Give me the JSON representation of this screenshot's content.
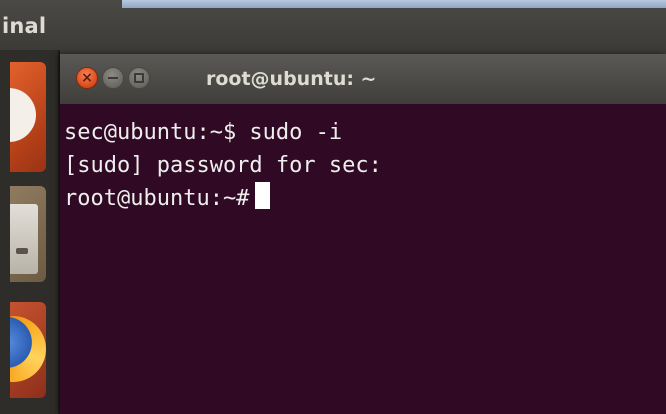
{
  "app": {
    "panel_title": "inal"
  },
  "launcher": {
    "items": [
      {
        "icon": "dash-home-icon"
      },
      {
        "icon": "files-icon"
      },
      {
        "icon": "firefox-icon"
      }
    ]
  },
  "window": {
    "title": "root@ubuntu: ~",
    "buttons": {
      "close_glyph": "×"
    }
  },
  "terminal": {
    "lines": [
      "sec@ubuntu:~$ sudo -i",
      "[sudo] password for sec:",
      "root@ubuntu:~#"
    ],
    "colors": {
      "background": "#300a24",
      "text": "#eeeeec"
    }
  }
}
